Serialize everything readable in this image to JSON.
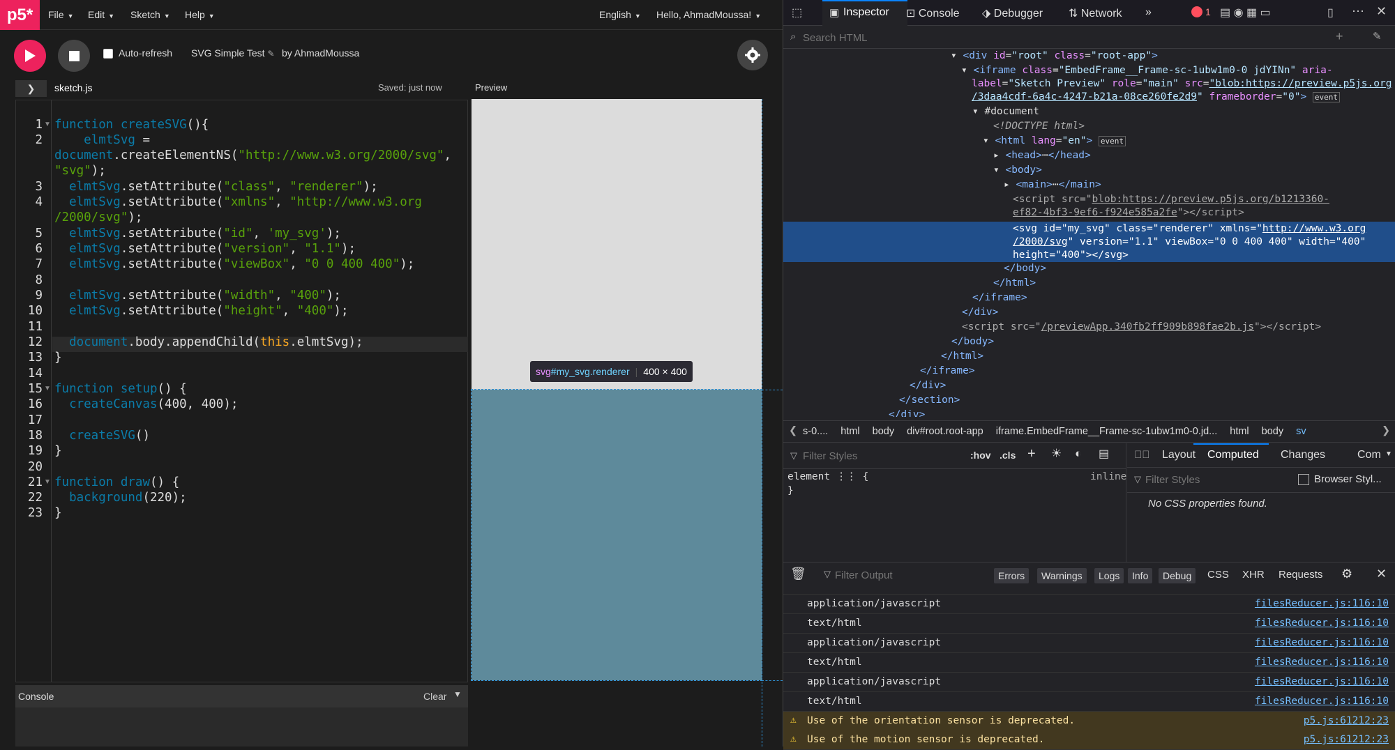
{
  "app": {
    "logo": "p5*"
  },
  "menu": {
    "file": "File",
    "edit": "Edit",
    "sketch": "Sketch",
    "help": "Help",
    "language": "English",
    "user": "Hello, AhmadMoussa!"
  },
  "toolbar": {
    "auto_refresh": "Auto-refresh",
    "sketch_name": "SVG Simple Test",
    "by": "by",
    "author": "AhmadMoussa"
  },
  "tabs": {
    "file": "sketch.js",
    "saved": "Saved: just now",
    "preview": "Preview"
  },
  "code": {
    "lines": [
      {
        "n": "1",
        "fold": true
      },
      {
        "n": "2"
      },
      {
        "n": ""
      },
      {
        "n": "3"
      },
      {
        "n": "4"
      },
      {
        "n": ""
      },
      {
        "n": "5"
      },
      {
        "n": "6"
      },
      {
        "n": "7"
      },
      {
        "n": "8"
      },
      {
        "n": "9"
      },
      {
        "n": "10"
      },
      {
        "n": "11"
      },
      {
        "n": "12"
      },
      {
        "n": "13"
      },
      {
        "n": "14"
      },
      {
        "n": "15",
        "fold": true
      },
      {
        "n": "16"
      },
      {
        "n": "17"
      },
      {
        "n": "18"
      },
      {
        "n": "19"
      },
      {
        "n": "20"
      },
      {
        "n": "21",
        "fold": true
      },
      {
        "n": "22"
      },
      {
        "n": "23"
      }
    ]
  },
  "console_panel": {
    "title": "Console",
    "clear": "Clear"
  },
  "tooltip": {
    "tag": "svg",
    "id": "#my_svg",
    "cls": ".renderer",
    "size": "400 × 400"
  },
  "devtools": {
    "tabs": {
      "inspector": "Inspector",
      "console": "Console",
      "debugger": "Debugger",
      "network": "Network",
      "errors": "1"
    },
    "search_placeholder": "Search HTML",
    "breadcrumbs": [
      "s-0....",
      "html",
      "body",
      "div#root.root-app",
      "iframe.EmbedFrame__Frame-sc-1ubw1m0-0.jd...",
      "html",
      "body",
      "sv"
    ],
    "rules": {
      "filter": "Filter Styles",
      "hov": ":hov",
      "cls": ".cls",
      "element": "element",
      "brace_open": "{",
      "brace_close": "}",
      "inline": "inline"
    },
    "computed": {
      "tabs": [
        "Layout",
        "Computed",
        "Changes",
        "Com"
      ],
      "filter": "Filter Styles",
      "browser_styles": "Browser Styl...",
      "empty": "No CSS properties found."
    },
    "output": {
      "filter": "Filter Output",
      "buttons": [
        "Errors",
        "Warnings",
        "Logs",
        "Info",
        "Debug"
      ],
      "extra": [
        "CSS",
        "XHR",
        "Requests"
      ],
      "messages": [
        {
          "text": "application/javascript",
          "src": "filesReducer.js:116:10"
        },
        {
          "text": "text/html",
          "src": "filesReducer.js:116:10"
        },
        {
          "text": "application/javascript",
          "src": "filesReducer.js:116:10"
        },
        {
          "text": "text/html",
          "src": "filesReducer.js:116:10"
        },
        {
          "text": "application/javascript",
          "src": "filesReducer.js:116:10"
        },
        {
          "text": "text/html",
          "src": "filesReducer.js:116:10"
        }
      ],
      "warnings": [
        {
          "text": "Use of the orientation sensor is deprecated.",
          "src": "p5.js:61212:23"
        },
        {
          "text": "Use of the motion sensor is deprecated.",
          "src": "p5.js:61212:23"
        }
      ]
    }
  }
}
